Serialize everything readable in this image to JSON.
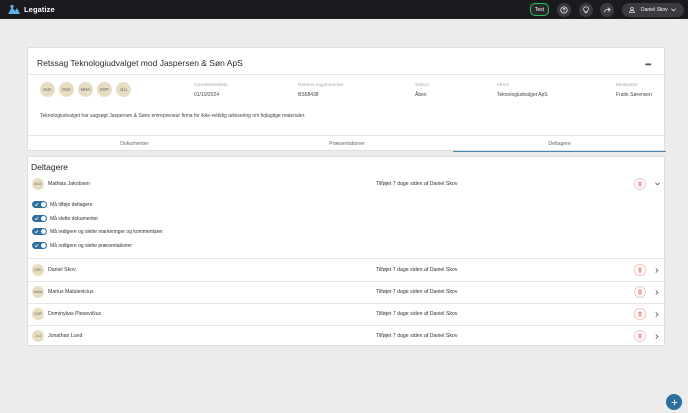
{
  "app": {
    "name": "Legatize"
  },
  "topbar": {
    "env_badge": "Test",
    "user_name": "Daniel Skov"
  },
  "case": {
    "title": "Retssag Teknologiudvalget mod Jaspersen & Søn ApS",
    "avatars": [
      "MJA",
      "DSK",
      "MMA",
      "DOP",
      "JLU"
    ],
    "meta": [
      {
        "label": "Oprettelsesdato",
        "value": "01/10/2024"
      },
      {
        "label": "Rettens sagsnummer",
        "value": "BS58438"
      },
      {
        "label": "Status",
        "value": "Åben"
      },
      {
        "label": "Klient",
        "value": "Teknologiudvalget ApS"
      },
      {
        "label": "Modparter",
        "value": "Frank Sørensen"
      }
    ],
    "description": "Teknologiudvalget har sagsøgt Jaspersen & Søns entrepreneur firma for ikke-rettidig advisering om fejlagtige materialer."
  },
  "tabs": [
    {
      "label": "Dokumenter",
      "active": false
    },
    {
      "label": "Præsentationer",
      "active": false
    },
    {
      "label": "Deltagere",
      "active": true
    }
  ],
  "participants": {
    "title": "Deltagere",
    "rows": [
      {
        "initials": "MJA",
        "name": "Mathias Jakobsen",
        "added": "Tilføjet 7 dage siden af Daniel Skov",
        "expanded": true
      },
      {
        "initials": "DSK",
        "name": "Daniel Skov",
        "added": "Tilføjet 7 dage siden af Daniel Skov",
        "expanded": false
      },
      {
        "initials": "MMA",
        "name": "Marius Matulevicius",
        "added": "Tilføjet 7 dage siden af Daniel Skov",
        "expanded": false
      },
      {
        "initials": "DOP",
        "name": "Dominykas Plesevičius",
        "added": "Tilføjet 7 dage siden af Daniel Skov",
        "expanded": false
      },
      {
        "initials": "JLU",
        "name": "Jonathan Lund",
        "added": "Tilføjet 7 dage siden af Daniel Skov",
        "expanded": false
      }
    ],
    "permissions": [
      {
        "label": "Må tilføje deltagere",
        "enabled": true
      },
      {
        "label": "Må slette dokumenter",
        "enabled": true
      },
      {
        "label": "Må redigere og slette markeringer og kommentarer",
        "enabled": true
      },
      {
        "label": "Må redigere og slette præsentationer",
        "enabled": true
      }
    ]
  },
  "colors": {
    "accent": "#2c6e9e",
    "test_badge": "#22c55e",
    "danger": "#e05252",
    "topbar": "#1b1b1f"
  }
}
